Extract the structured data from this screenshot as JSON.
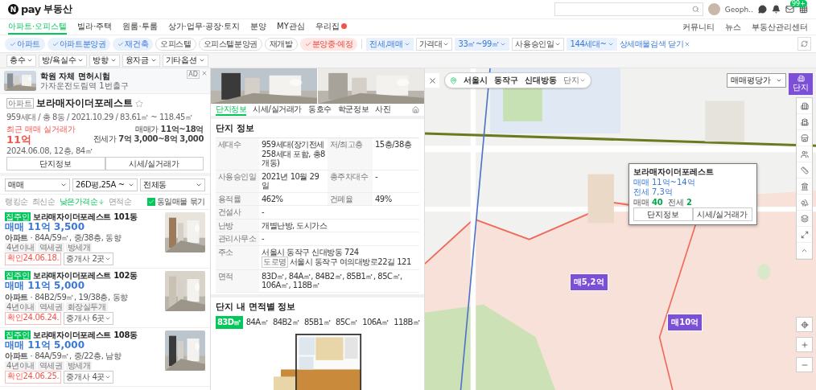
{
  "header": {
    "logo": {
      "mark": "N",
      "pay": "pay",
      "title": "부동산"
    },
    "user": {
      "name": "Geoph.."
    },
    "mail_badge": "99+"
  },
  "nav": {
    "tabs": [
      {
        "label": "아파트·오피스텔",
        "selected": true,
        "new": false
      },
      {
        "label": "빌라·주택",
        "selected": false,
        "new": false
      },
      {
        "label": "원룸·투룸",
        "selected": false,
        "new": false
      },
      {
        "label": "상가·업무·공장·토지",
        "selected": false,
        "new": false
      },
      {
        "label": "분양",
        "selected": false,
        "new": false
      },
      {
        "label": "MY관심",
        "selected": false,
        "new": false
      },
      {
        "label": "우리집",
        "selected": false,
        "new": true
      }
    ],
    "links": [
      "커뮤니티",
      "뉴스",
      "부동산관리센터"
    ]
  },
  "filters": {
    "types": [
      {
        "label": "아파트",
        "checked": true,
        "kind": "type"
      },
      {
        "label": "아파트분양권",
        "checked": true,
        "kind": "type"
      },
      {
        "label": "재건축",
        "checked": true,
        "kind": "type"
      },
      {
        "label": "오피스텔",
        "checked": false,
        "kind": "type"
      },
      {
        "label": "오피스텔분양권",
        "checked": false,
        "kind": "type"
      },
      {
        "label": "재개발",
        "checked": false,
        "kind": "type"
      },
      {
        "label": "분양중·예정",
        "checked": true,
        "kind": "presale"
      }
    ],
    "options": [
      {
        "label": "전세,매매",
        "active": true
      },
      {
        "label": "가격대",
        "active": false
      },
      {
        "label": "33㎡~99㎡",
        "active": true
      },
      {
        "label": "사용승인일",
        "active": false
      },
      {
        "label": "144세대~",
        "active": true
      }
    ],
    "close_link": "상세매물검색 닫기",
    "more": [
      "층수",
      "방/욕실수",
      "방향",
      "융자금",
      "기타옵션"
    ]
  },
  "ad": {
    "title": "학원 자체 면허시험",
    "subtitle": "가자운전도림역 1번출구",
    "badge": "AD"
  },
  "complex": {
    "tag": "아파트",
    "name": "보라매자이더포레스트",
    "favorite": false,
    "summary": "959세대 / 총 8동 / 2021.10.29 / 83.61㎡ ~ 118.45㎡",
    "recent_label": "최근 매매 실거래가",
    "recent_price": "11억",
    "recent_detail": "2024.06.08, 12층, 84㎡",
    "prices": [
      {
        "label": "매매가",
        "value": "11억~18억"
      },
      {
        "label": "전세가",
        "value": "7억 3,000~8억 3,000"
      }
    ],
    "buttons": [
      "단지정보",
      "시세/실거래가"
    ]
  },
  "listing_filters": {
    "selects": [
      "매매",
      "26D평,25A ~",
      "전체동"
    ],
    "sorts": [
      {
        "label": "랭킹순",
        "selected": false
      },
      {
        "label": "최신순",
        "selected": false
      },
      {
        "label": "낮은가격순",
        "selected": true
      },
      {
        "label": "면적순",
        "selected": false
      }
    ],
    "group_same": {
      "label": "동일매물 묶기",
      "checked": true
    }
  },
  "listings": [
    {
      "tag": "집주인",
      "title": "보라매자이더포레스트 101동",
      "price": "매매 11억 3,500",
      "spec": "**아파트** · 84A/59㎡, 중/38층, 동향",
      "features": [
        "4년이내",
        "역세권",
        "방세개"
      ],
      "confirmed": "확인24.06.18.",
      "agents": "중개사 2곳"
    },
    {
      "tag": "집주인",
      "title": "보라매자이더포레스트 102동",
      "price": "매매 11억 5,000",
      "spec": "**아파트** · 84B2/59㎡, 19/38층, 동향",
      "features": [
        "4년이내",
        "역세권",
        "화장실두개"
      ],
      "confirmed": "확인24.06.24.",
      "agents": "중개사 6곳"
    },
    {
      "tag": "집주인",
      "title": "보라매자이더포레스트 108동",
      "price": "매매 11억 5,000",
      "spec": "**아파트** · 84A/59㎡, 중/22층, 남향",
      "features": [
        "4년이내",
        "역세권",
        "방세개"
      ],
      "confirmed": "확인24.06.25.",
      "agents": "중개사 4곳"
    }
  ],
  "detail": {
    "tabs": [
      {
        "label": "단지정보",
        "selected": true
      },
      {
        "label": "시세/실거래가",
        "selected": false
      },
      {
        "label": "동호수",
        "selected": false
      },
      {
        "label": "학군정보",
        "selected": false
      },
      {
        "label": "사진",
        "selected": false
      }
    ],
    "section_title": "단지 정보",
    "info": [
      {
        "label": "세대수",
        "value": "959세대(장기전세 258세대 포함, 총8개동)",
        "label_2": "저/최고층",
        "value_2": "15층/38층"
      },
      {
        "label": "사용승인일",
        "value": "2021년 10월 29일",
        "label_2": "총주차대수",
        "value_2": "-"
      },
      {
        "label": "용적률",
        "value": "462%",
        "label_2": "건폐율",
        "value_2": "49%"
      },
      {
        "label": "건설사",
        "value": "-"
      },
      {
        "label": "난방",
        "value": "개별난방, 도시가스"
      },
      {
        "label": "관리사무소",
        "value": "-"
      },
      {
        "label": "주소",
        "value": "서울시 동작구 신대방동 724",
        "road_tag": "도로명",
        "road": "서울시 동작구 여의대방로22길 121"
      },
      {
        "label": "면적",
        "value": "83D㎡, 84A㎡, 84B2㎡, 85B1㎡, 85C㎡, 106A㎡, 118B㎡"
      }
    ],
    "area_title": "단지 내 면적별 정보",
    "area_tabs": [
      {
        "label": "83D㎡",
        "selected": true
      },
      {
        "label": "84A㎡",
        "selected": false
      },
      {
        "label": "84B2㎡",
        "selected": false
      },
      {
        "label": "85B1㎡",
        "selected": false
      },
      {
        "label": "85C㎡",
        "selected": false
      },
      {
        "label": "106A㎡",
        "selected": false
      },
      {
        "label": "118B㎡",
        "selected": false
      }
    ]
  },
  "map": {
    "breadcrumb": [
      "서울시",
      "동작구",
      "신대방동"
    ],
    "scope": "단지",
    "price_select": "매매평당가",
    "mode_button": "단지",
    "popup": {
      "name": "보라매자이더포레스트",
      "sale": "매매 11억~14억",
      "rent": "전세 7,3억",
      "counts": [
        {
          "label": "매매",
          "value": "40"
        },
        {
          "label": "전세",
          "value": "2"
        }
      ],
      "buttons": [
        "단지정보",
        "시세/실거래가"
      ]
    },
    "markers": [
      {
        "label": "매5,2억"
      },
      {
        "label": "매10억"
      }
    ]
  }
}
